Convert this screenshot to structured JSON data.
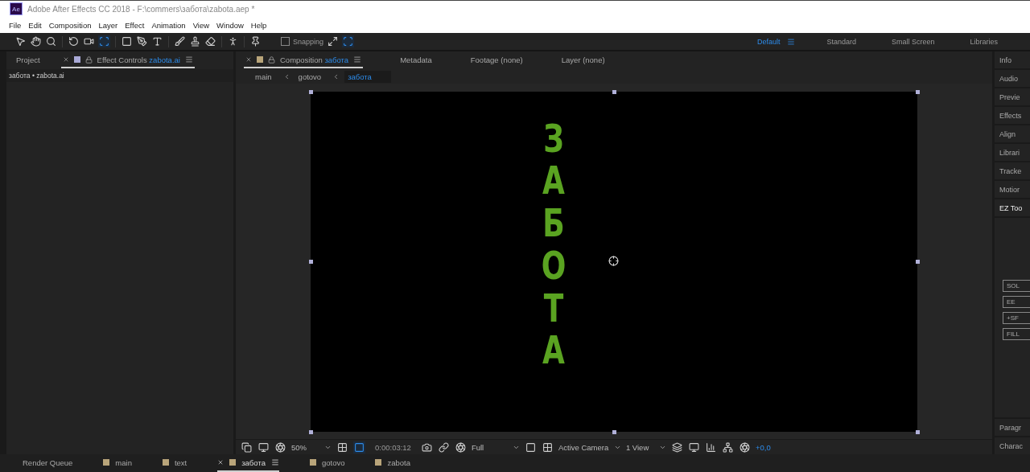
{
  "window": {
    "logo": "Ae",
    "title": "Adobe After Effects CC 2018 - F:\\commers\\забота\\zabota.aep *"
  },
  "menu": [
    "File",
    "Edit",
    "Composition",
    "Layer",
    "Effect",
    "Animation",
    "View",
    "Window",
    "Help"
  ],
  "toolbar": {
    "snapping": {
      "label": "Snapping",
      "checked": false
    }
  },
  "workspaces": [
    {
      "label": "Default",
      "selected": true
    },
    {
      "label": "Standard",
      "selected": false
    },
    {
      "label": "Small Screen",
      "selected": false
    },
    {
      "label": "Libraries",
      "selected": false
    }
  ],
  "left_panel": {
    "tabs": [
      {
        "label": "Project",
        "kind": "plain",
        "selected": false
      },
      {
        "label": "Effect Controls",
        "target": "zabota.ai",
        "kind": "effects",
        "selected": true
      }
    ],
    "subtitle": "забота • zabota.ai"
  },
  "viewer": {
    "tabs": [
      {
        "label": "Composition",
        "target": "забота",
        "kind": "comp",
        "selected": true
      },
      {
        "label": "Metadata",
        "kind": "plain",
        "selected": false
      },
      {
        "label": "Footage (none)",
        "kind": "plain",
        "selected": false
      },
      {
        "label": "Layer (none)",
        "kind": "plain",
        "selected": false
      }
    ],
    "breadcrumbs": [
      {
        "label": "main",
        "selected": false
      },
      {
        "label": "gotovo",
        "selected": false
      },
      {
        "label": "забота",
        "selected": true
      }
    ],
    "canvas_text": "ЗАБОТА",
    "controls": {
      "zoom": "50%",
      "timecode": "0:00:03:12",
      "resolution": "Full",
      "camera": "Active Camera",
      "views": "1 View",
      "exposure": "+0,0"
    }
  },
  "right_panel": {
    "items": [
      {
        "label": "Info",
        "expanded": false
      },
      {
        "label": "Audio",
        "expanded": false
      },
      {
        "label": "Previe",
        "expanded": false
      },
      {
        "label": "Effects",
        "expanded": false
      },
      {
        "label": "Align",
        "expanded": false
      },
      {
        "label": "Librari",
        "expanded": false
      },
      {
        "label": "Tracke",
        "expanded": false
      },
      {
        "label": "Motior",
        "expanded": false
      },
      {
        "label": "EZ Too",
        "expanded": true
      },
      {
        "label": "Paragr",
        "expanded": false
      },
      {
        "label": "Charac",
        "expanded": false
      }
    ],
    "buttons": [
      "SOL",
      "EE",
      "+SF",
      "FILL"
    ]
  },
  "timeline_tabs": [
    {
      "label": "Render Queue",
      "kind": "queue",
      "selected": false
    },
    {
      "label": "main",
      "kind": "comp",
      "selected": false
    },
    {
      "label": "text",
      "kind": "comp",
      "selected": false
    },
    {
      "label": "забота",
      "kind": "comp",
      "selected": true
    },
    {
      "label": "gotovo",
      "kind": "comp",
      "selected": false
    },
    {
      "label": "zabota",
      "kind": "comp",
      "selected": false
    }
  ]
}
